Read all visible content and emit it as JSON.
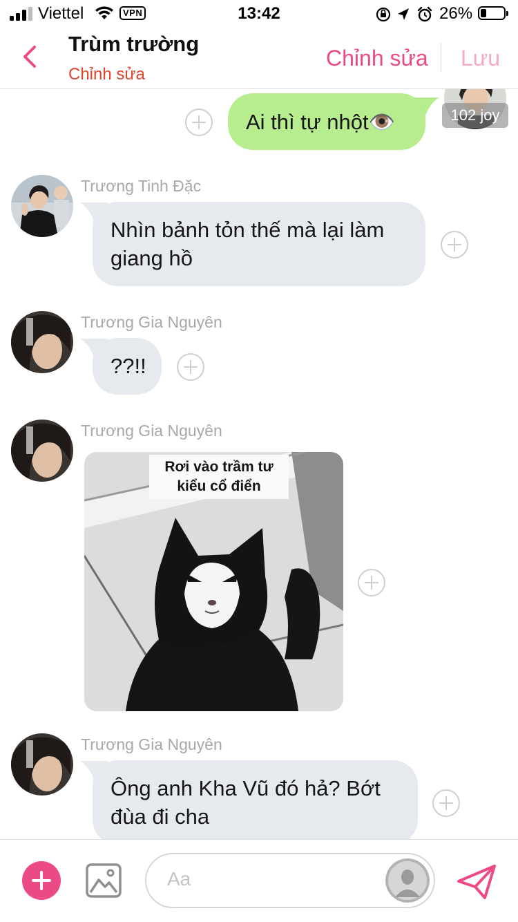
{
  "status_bar": {
    "carrier": "Viettel",
    "vpn_label": "VPN",
    "time": "13:42",
    "battery_percent_label": "26%",
    "battery_level": 0.26
  },
  "header": {
    "title": "Trùm trường",
    "subtitle": "Chỉnh sửa",
    "edit_label": "Chỉnh sửa",
    "save_label": "Lưu"
  },
  "messages": [
    {
      "direction": "out",
      "text": "Ai thì tự nhột👁️",
      "self_label": "102 joy"
    },
    {
      "direction": "in",
      "sender": "Trương Tinh Đặc",
      "text": "Nhìn bảnh tỏn thế mà lại làm giang hồ"
    },
    {
      "direction": "in",
      "sender": "Trương Gia Nguyên",
      "text": "??!!"
    },
    {
      "direction": "in",
      "sender": "Trương Gia Nguyên",
      "type": "image",
      "caption": "Rơi vào trầm tư kiểu cổ điển"
    },
    {
      "direction": "in",
      "sender": "Trương Gia Nguyên",
      "text": "Ông anh Kha Vũ đó hả? Bớt đùa đi cha"
    }
  ],
  "composer": {
    "placeholder": "Aa"
  },
  "colors": {
    "accent": "#ec4a86",
    "accent_light": "#f5a9c6",
    "subtitle_red": "#e0452c",
    "incoming_bubble": "#e6e9ee",
    "outgoing_bubble": "#b7ec8f",
    "sender_name": "#a8a8a8"
  },
  "icons": {
    "back": "chevron-left-icon",
    "add": "plus-icon",
    "gallery": "image-icon",
    "send": "send-icon",
    "react": "add-reaction-icon"
  }
}
